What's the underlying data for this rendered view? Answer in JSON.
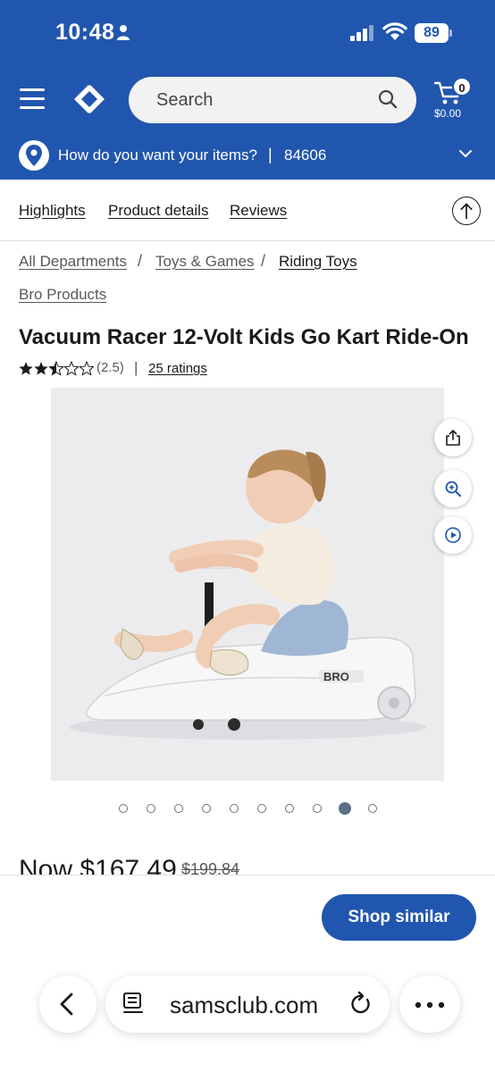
{
  "status_bar": {
    "time": "10:48",
    "battery": "89"
  },
  "header": {
    "search_placeholder": "Search",
    "cart_count": "0",
    "cart_total": "$0.00"
  },
  "location": {
    "question": "How do you want your items?",
    "separator": "|",
    "zip": "84606"
  },
  "subnav": {
    "items": [
      "Highlights",
      "Product details",
      "Reviews"
    ]
  },
  "breadcrumb": {
    "items": [
      "All Departments",
      "Toys & Games",
      "Riding Toys",
      "Bro Products"
    ],
    "separator": "/"
  },
  "product": {
    "title": "Vacuum Racer 12-Volt Kids Go Kart Ride-On",
    "rating_value": "(2.5)",
    "rating_stars": 2.5,
    "rating_separator": "|",
    "rating_count": "25 ratings",
    "price_now": "Now $167.49",
    "price_was": "$199.84"
  },
  "gallery": {
    "total": 10,
    "active_index": 8
  },
  "cta": {
    "shop_similar": "Shop similar"
  },
  "browser": {
    "url": "samsclub.com"
  },
  "colors": {
    "brand_blue": "#2156ae",
    "active_dot": "#5b6f86"
  }
}
